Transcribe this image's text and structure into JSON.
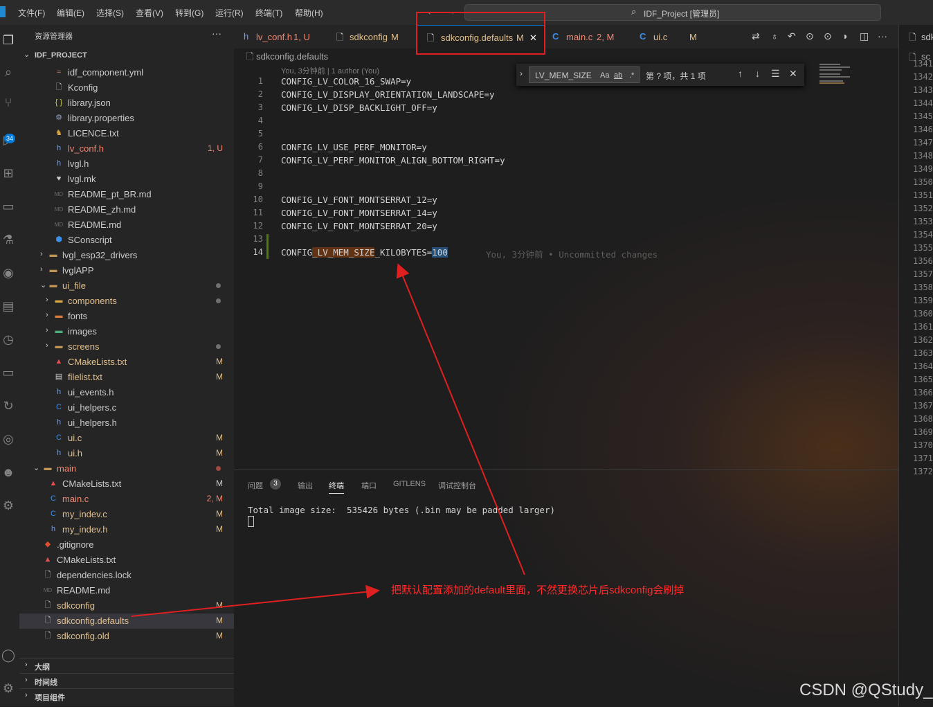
{
  "menubar": {
    "items": [
      "文件(F)",
      "编辑(E)",
      "选择(S)",
      "查看(V)",
      "转到(G)",
      "运行(R)",
      "终端(T)",
      "帮助(H)"
    ],
    "command_center": "IDF_Project [管理员]"
  },
  "activity_bar": {
    "scm_badge": "34"
  },
  "sidebar": {
    "title": "资源管理器",
    "project": "IDF_PROJECT",
    "items": [
      {
        "label": "idf_component.yml",
        "status": ""
      },
      {
        "label": "Kconfig",
        "status": ""
      },
      {
        "label": "library.json",
        "status": "",
        "icon_text": "{ }"
      },
      {
        "label": "library.properties",
        "status": ""
      },
      {
        "label": "LICENCE.txt",
        "status": ""
      },
      {
        "label": "lv_conf.h",
        "status": "1, U",
        "icon_text": "h"
      },
      {
        "label": "lvgl.h",
        "status": "",
        "icon_text": "h"
      },
      {
        "label": "lvgl.mk",
        "status": ""
      },
      {
        "label": "README_pt_BR.md",
        "status": ""
      },
      {
        "label": "README_zh.md",
        "status": ""
      },
      {
        "label": "README.md",
        "status": ""
      },
      {
        "label": "SConscript",
        "status": ""
      },
      {
        "label": "lvgl_esp32_drivers",
        "status": ""
      },
      {
        "label": "lvglAPP",
        "status": ""
      },
      {
        "label": "ui_file",
        "status": ""
      },
      {
        "label": "components",
        "status": ""
      },
      {
        "label": "fonts",
        "status": ""
      },
      {
        "label": "images",
        "status": ""
      },
      {
        "label": "screens",
        "status": ""
      },
      {
        "label": "CMakeLists.txt",
        "status": "M"
      },
      {
        "label": "filelist.txt",
        "status": "M"
      },
      {
        "label": "ui_events.h",
        "status": "",
        "icon_text": "h"
      },
      {
        "label": "ui_helpers.c",
        "status": "",
        "icon_text": "C"
      },
      {
        "label": "ui_helpers.h",
        "status": "",
        "icon_text": "h"
      },
      {
        "label": "ui.c",
        "status": "M",
        "icon_text": "C"
      },
      {
        "label": "ui.h",
        "status": "M",
        "icon_text": "h"
      },
      {
        "label": "main",
        "status": ""
      },
      {
        "label": "CMakeLists.txt",
        "status": "M"
      },
      {
        "label": "main.c",
        "status": "2, M",
        "icon_text": "C"
      },
      {
        "label": "my_indev.c",
        "status": "M",
        "icon_text": "C"
      },
      {
        "label": "my_indev.h",
        "status": "M",
        "icon_text": "h"
      },
      {
        "label": ".gitignore",
        "status": ""
      },
      {
        "label": "CMakeLists.txt",
        "status": ""
      },
      {
        "label": "dependencies.lock",
        "status": ""
      },
      {
        "label": "README.md",
        "status": ""
      },
      {
        "label": "sdkconfig",
        "status": "M"
      },
      {
        "label": "sdkconfig.defaults",
        "status": "M"
      },
      {
        "label": "sdkconfig.old",
        "status": "M"
      }
    ],
    "sections": [
      "大纲",
      "时间线",
      "项目组件"
    ]
  },
  "tabs": [
    {
      "label": "lv_conf.h",
      "badge": "1, U",
      "icon_text": "h"
    },
    {
      "label": "sdkconfig",
      "badge": "M"
    },
    {
      "label": "sdkconfig.defaults",
      "badge": "M",
      "close": "✕"
    },
    {
      "label": "main.c",
      "badge": "2, M",
      "icon_text": "C"
    },
    {
      "label": "ui.c",
      "badge": "M",
      "icon_text": "C"
    }
  ],
  "editor": {
    "breadcrumb": "sdkconfig.defaults",
    "blame": "You, 3分钟前 | 1 author (You)",
    "lines": [
      {
        "n": "1",
        "text": "CONFIG_LV_COLOR_16_SWAP=y"
      },
      {
        "n": "2",
        "text": "CONFIG_LV_DISPLAY_ORIENTATION_LANDSCAPE=y"
      },
      {
        "n": "3",
        "text": "CONFIG_LV_DISP_BACKLIGHT_OFF=y"
      },
      {
        "n": "4",
        "text": ""
      },
      {
        "n": "5",
        "text": ""
      },
      {
        "n": "6",
        "text": "CONFIG_LV_USE_PERF_MONITOR=y"
      },
      {
        "n": "7",
        "text": "CONFIG_LV_PERF_MONITOR_ALIGN_BOTTOM_RIGHT=y"
      },
      {
        "n": "8",
        "text": ""
      },
      {
        "n": "9",
        "text": ""
      },
      {
        "n": "10",
        "text": "CONFIG_LV_FONT_MONTSERRAT_12=y"
      },
      {
        "n": "11",
        "text": "CONFIG_LV_FONT_MONTSERRAT_14=y"
      },
      {
        "n": "12",
        "text": "CONFIG_LV_FONT_MONTSERRAT_20=y"
      },
      {
        "n": "13",
        "text": ""
      }
    ],
    "line14": {
      "n": "14",
      "pre": "CONFIG",
      "match": "_LV_MEM_SIZE",
      "post": "_KILOBYTES=",
      "value": "100"
    },
    "ghost": "You, 3分钟前 • Uncommitted changes"
  },
  "find_widget": {
    "query": "LV_MEM_SIZE",
    "match_case": "Aa",
    "whole_word": "ab",
    "regex": ".*",
    "count": "第 ? 项，共 1 项"
  },
  "right_pane": {
    "tab": "sdk",
    "crumb": "sc",
    "line_numbers": [
      "1341",
      "1342",
      "1343",
      "1344",
      "1345",
      "1346",
      "1347",
      "1348",
      "1349",
      "1350",
      "1351",
      "1352",
      "1353",
      "1354",
      "1355",
      "1356",
      "1357",
      "1358",
      "1359",
      "1360",
      "1361",
      "1362",
      "1363",
      "1364",
      "1365",
      "1366",
      "1367",
      "1368",
      "1369",
      "1370",
      "1371",
      "1372"
    ]
  },
  "panel": {
    "tabs": [
      "问题",
      "输出",
      "终端",
      "端口",
      "GITLENS",
      "调试控制台"
    ],
    "problems_count": "3",
    "active_tab": "终端",
    "terminal_line": "Total image size:  535426 bytes (.bin may be padded larger)"
  },
  "annotation": {
    "text": "把默认配置添加的default里面，不然更换芯片后sdkconfig会刷掉",
    "color": "#e02020"
  },
  "watermark": "CSDN @QStudy_",
  "colors": {
    "accent": "#0078d4",
    "modified": "#e2c08d",
    "untracked": "#73c991",
    "error": "#f48771"
  }
}
